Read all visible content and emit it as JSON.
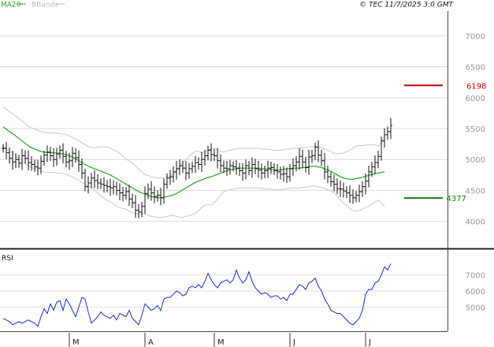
{
  "header": {
    "legend": [
      {
        "label": "MA20",
        "color": "#22aa22"
      },
      {
        "label": "BBands",
        "color": "#bbbbbb"
      }
    ],
    "copyright": "© TEC 11/7/2025 3:0 GMT"
  },
  "chart_data": [
    {
      "type": "ohlc",
      "ylim": [
        3600,
        7400
      ],
      "yticks": [
        {
          "value": 4000,
          "label": "4000"
        },
        {
          "value": 4500,
          "label": "4500"
        },
        {
          "value": 5000,
          "label": "5000"
        },
        {
          "value": 5500,
          "label": "5500"
        },
        {
          "value": 6000,
          "label": "6000"
        },
        {
          "value": 6500,
          "label": "6500"
        },
        {
          "value": 7000,
          "label": "7000"
        }
      ],
      "grid": true,
      "months": [
        {
          "label": "M",
          "index": 21
        },
        {
          "label": "A",
          "index": 45
        },
        {
          "label": "M",
          "index": 67
        },
        {
          "label": "J",
          "index": 91
        },
        {
          "label": "J",
          "index": 115
        }
      ],
      "levels": [
        {
          "value": 6198,
          "label": "6198",
          "color": "#cc0000"
        },
        {
          "value": 4377,
          "label": "4377",
          "color": "#118811"
        }
      ],
      "close": [
        5180,
        5110,
        5020,
        4960,
        5000,
        4940,
        5060,
        5020,
        4950,
        4920,
        4880,
        4860,
        4970,
        5070,
        5120,
        5060,
        5000,
        5090,
        5150,
        5050,
        4960,
        4980,
        5100,
        5030,
        4920,
        4780,
        4560,
        4620,
        4700,
        4660,
        4620,
        4600,
        4580,
        4560,
        4540,
        4560,
        4500,
        4460,
        4420,
        4480,
        4360,
        4300,
        4180,
        4150,
        4240,
        4450,
        4520,
        4460,
        4400,
        4420,
        4380,
        4600,
        4700,
        4720,
        4800,
        4850,
        4900,
        4860,
        4780,
        4850,
        4890,
        4950,
        4920,
        5000,
        5060,
        5150,
        5080,
        5060,
        4980,
        4900,
        4860,
        4850,
        4900,
        4880,
        4860,
        4820,
        4780,
        4900,
        4820,
        4920,
        4850,
        4830,
        4780,
        4820,
        4860,
        4870,
        4820,
        4800,
        4760,
        4770,
        4720,
        4850,
        4900,
        4960,
        5050,
        4960,
        4870,
        5040,
        5060,
        5200,
        5070,
        4980,
        4800,
        4720,
        4640,
        4600,
        4530,
        4520,
        4490,
        4460,
        4420,
        4380,
        4420,
        4480,
        4560,
        4650,
        4800,
        4880,
        4950,
        5050,
        5300,
        5400,
        5450,
        5550
      ],
      "ma20": [
        5530,
        5490,
        5450,
        5420,
        5380,
        5340,
        5300,
        5260,
        5220,
        5190,
        5170,
        5150,
        5130,
        5120,
        5110,
        5110,
        5110,
        5100,
        5100,
        5090,
        5080,
        5060,
        5040,
        5010,
        4980,
        4950,
        4920,
        4890,
        4870,
        4850,
        4830,
        4810,
        4790,
        4770,
        4750,
        4720,
        4690,
        4660,
        4630,
        4600,
        4570,
        4540,
        4510,
        4480,
        4460,
        4440,
        4420,
        4400,
        4390,
        4380,
        4380,
        4390,
        4400,
        4410,
        4430,
        4450,
        4480,
        4510,
        4540,
        4570,
        4600,
        4630,
        4650,
        4670,
        4690,
        4710,
        4720,
        4740,
        4760,
        4780,
        4800,
        4820,
        4830,
        4840,
        4850,
        4860,
        4860,
        4860,
        4860,
        4860,
        4860,
        4860,
        4850,
        4850,
        4840,
        4840,
        4830,
        4830,
        4830,
        4840,
        4850,
        4850,
        4860,
        4860,
        4860,
        4870,
        4870,
        4880,
        4890,
        4890,
        4880,
        4870,
        4850,
        4830,
        4810,
        4780,
        4750,
        4720,
        4700,
        4690,
        4680,
        4680,
        4690,
        4700,
        4710,
        4730,
        4740,
        4760,
        4770,
        4780,
        4790,
        4800
      ]
    },
    {
      "type": "line",
      "title": "RSI",
      "ylim": [
        35,
        85
      ],
      "yticks": [
        {
          "value": 50,
          "label": "5000"
        },
        {
          "value": 60,
          "label": "6000"
        },
        {
          "value": 70,
          "label": "7000"
        }
      ],
      "values": [
        43,
        42,
        41,
        39,
        40,
        41,
        40,
        41,
        42,
        41,
        40,
        38,
        44,
        49,
        46,
        52,
        48,
        53,
        54,
        48,
        55,
        52,
        48,
        44,
        50,
        56,
        55,
        47,
        40,
        42,
        44,
        47,
        45,
        44,
        43,
        45,
        42,
        46,
        45,
        44,
        48,
        43,
        41,
        39,
        45,
        52,
        50,
        48,
        49,
        51,
        48,
        55,
        56,
        56,
        58,
        60,
        59,
        57,
        58,
        62,
        63,
        62,
        64,
        62,
        66,
        71,
        67,
        64,
        62,
        65,
        66,
        67,
        65,
        67,
        73,
        68,
        65,
        67,
        72,
        66,
        62,
        60,
        58,
        59,
        58,
        56,
        57,
        57,
        55,
        56,
        54,
        58,
        58,
        61,
        64,
        63,
        61,
        65,
        66,
        68,
        63,
        60,
        55,
        52,
        48,
        47,
        46,
        46,
        44,
        42,
        40,
        39,
        41,
        43,
        48,
        58,
        61,
        61,
        65,
        66,
        70,
        75,
        73,
        77
      ]
    }
  ]
}
